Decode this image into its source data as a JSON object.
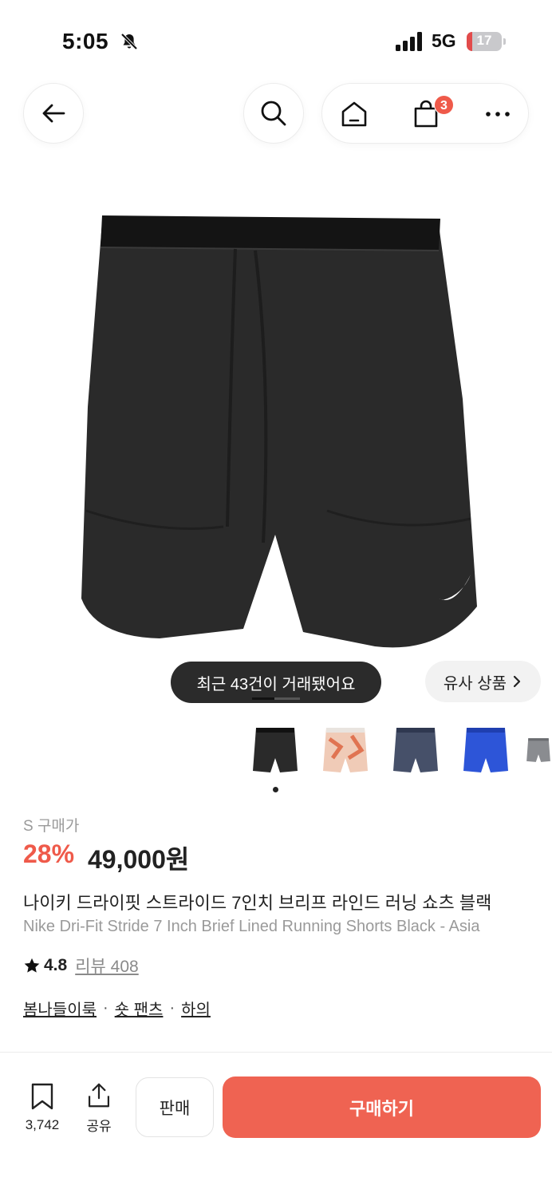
{
  "status_bar": {
    "time": "5:05",
    "network": "5G",
    "battery_level": "17",
    "battery_fraction": 0.17,
    "icons": [
      "bell-muted-icon",
      "signal-icon",
      "battery-icon"
    ]
  },
  "nav": {
    "icons": [
      "back-arrow-icon",
      "search-icon",
      "home-icon",
      "shopping-bag-icon",
      "more-icon"
    ],
    "cart_count": "3"
  },
  "gallery": {
    "recent_trades": "최근 43건이 거래됐어요",
    "similar_label": "유사 상품",
    "thumbnail_count": 5,
    "active_index": 0
  },
  "product": {
    "size_label": "S 구매가",
    "discount": "28%",
    "price": "49,000원",
    "title_ko": "나이키 드라이핏 스트라이드 7인치 브리프 라인드 러닝 쇼츠 블랙",
    "title_en": "Nike Dri-Fit Stride 7 Inch Brief Lined Running Shorts Black - Asia",
    "rating": "4.8",
    "review_label": "리뷰 408",
    "tags": [
      "봄나들이룩",
      "숏 팬츠",
      "하의"
    ],
    "tag_separator": "·"
  },
  "bottom_bar": {
    "bookmark_count": "3,742",
    "share_label": "공유",
    "sell_label": "판매",
    "buy_label": "구매하기"
  },
  "colors": {
    "accent": "#ef6352",
    "discount": "#ef5a4a",
    "muted_text": "#9a9a9a"
  }
}
